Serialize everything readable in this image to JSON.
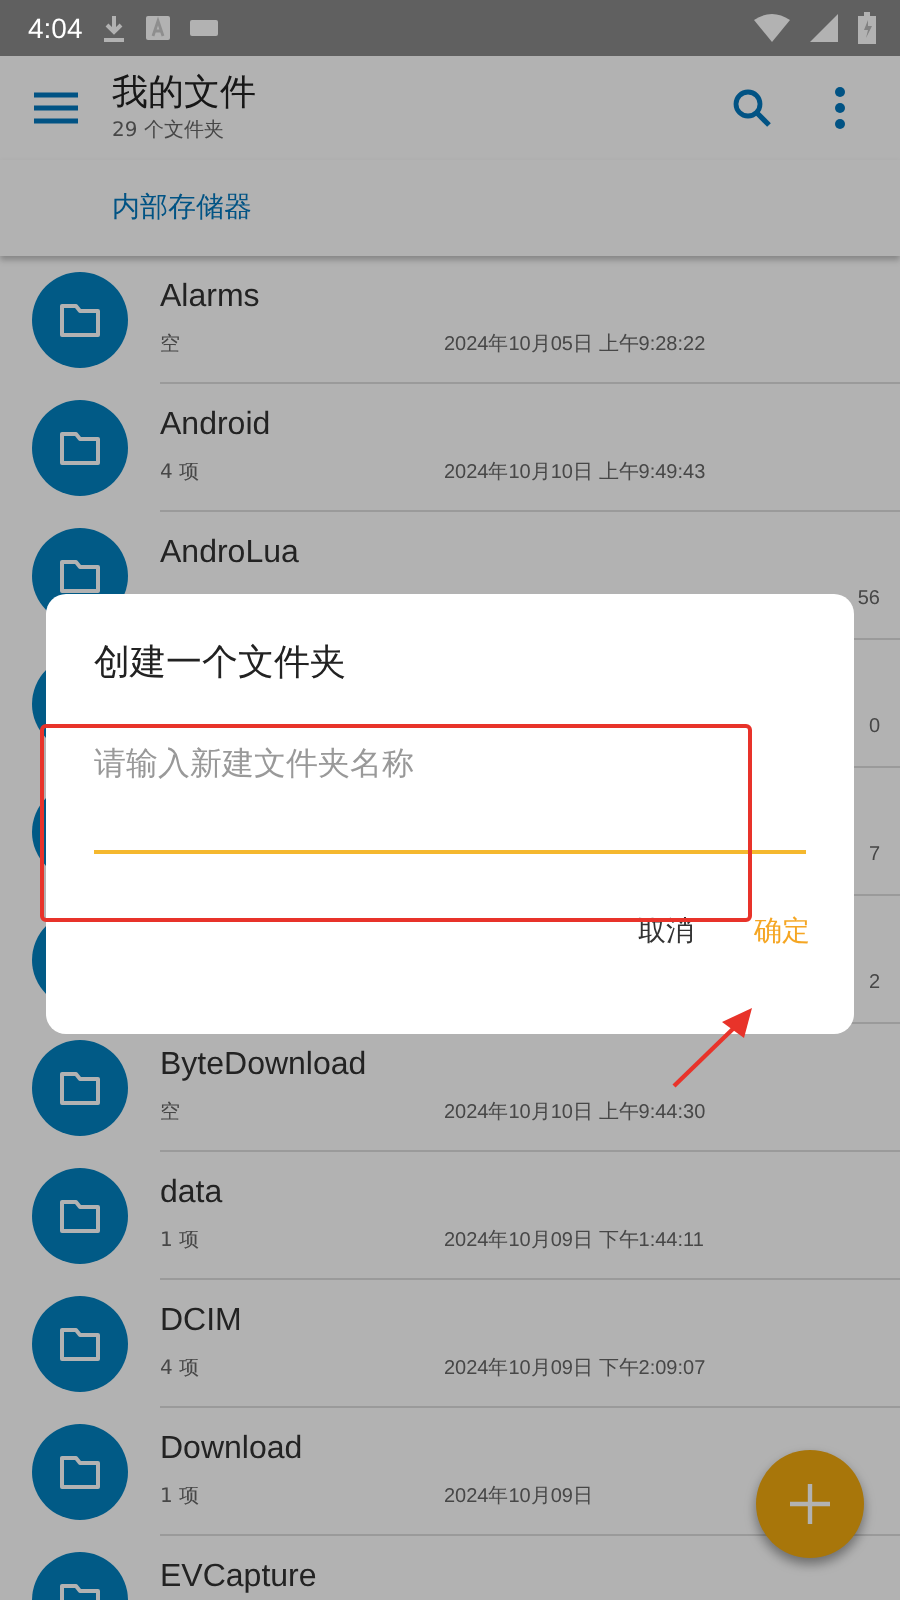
{
  "status_bar": {
    "time": "4:04"
  },
  "toolbar": {
    "title": "我的文件",
    "subtitle": "29 个文件夹"
  },
  "breadcrumb": {
    "label": "内部存储器"
  },
  "rows": [
    {
      "kind": "folder",
      "name": "Alarms",
      "info": "空",
      "date": "2024年10月05日 上午9:28:22"
    },
    {
      "kind": "folder",
      "name": "Android",
      "info": "4 项",
      "date": "2024年10月10日 上午9:49:43"
    },
    {
      "kind": "covered",
      "name": "AndroLua",
      "date": "56"
    },
    {
      "kind": "covered",
      "date": "0"
    },
    {
      "kind": "covered",
      "date": "7"
    },
    {
      "kind": "covered",
      "date": "2"
    },
    {
      "kind": "folder",
      "name": "ByteDownload",
      "info": "空",
      "date": "2024年10月10日 上午9:44:30"
    },
    {
      "kind": "folder",
      "name": "data",
      "info": "1 项",
      "date": "2024年10月09日 下午1:44:11"
    },
    {
      "kind": "folder",
      "name": "DCIM",
      "info": "4 项",
      "date": "2024年10月09日 下午2:09:07"
    },
    {
      "kind": "folder",
      "name": "Download",
      "info": "1 项",
      "date": "2024年10月09日"
    },
    {
      "kind": "folder",
      "name": "EVCapture"
    }
  ],
  "dialog": {
    "title": "创建一个文件夹",
    "placeholder": "请输入新建文件夹名称",
    "buttons": [
      {
        "label": "取消",
        "kind": "cancel"
      },
      {
        "label": "确定",
        "kind": "confirm"
      }
    ]
  }
}
